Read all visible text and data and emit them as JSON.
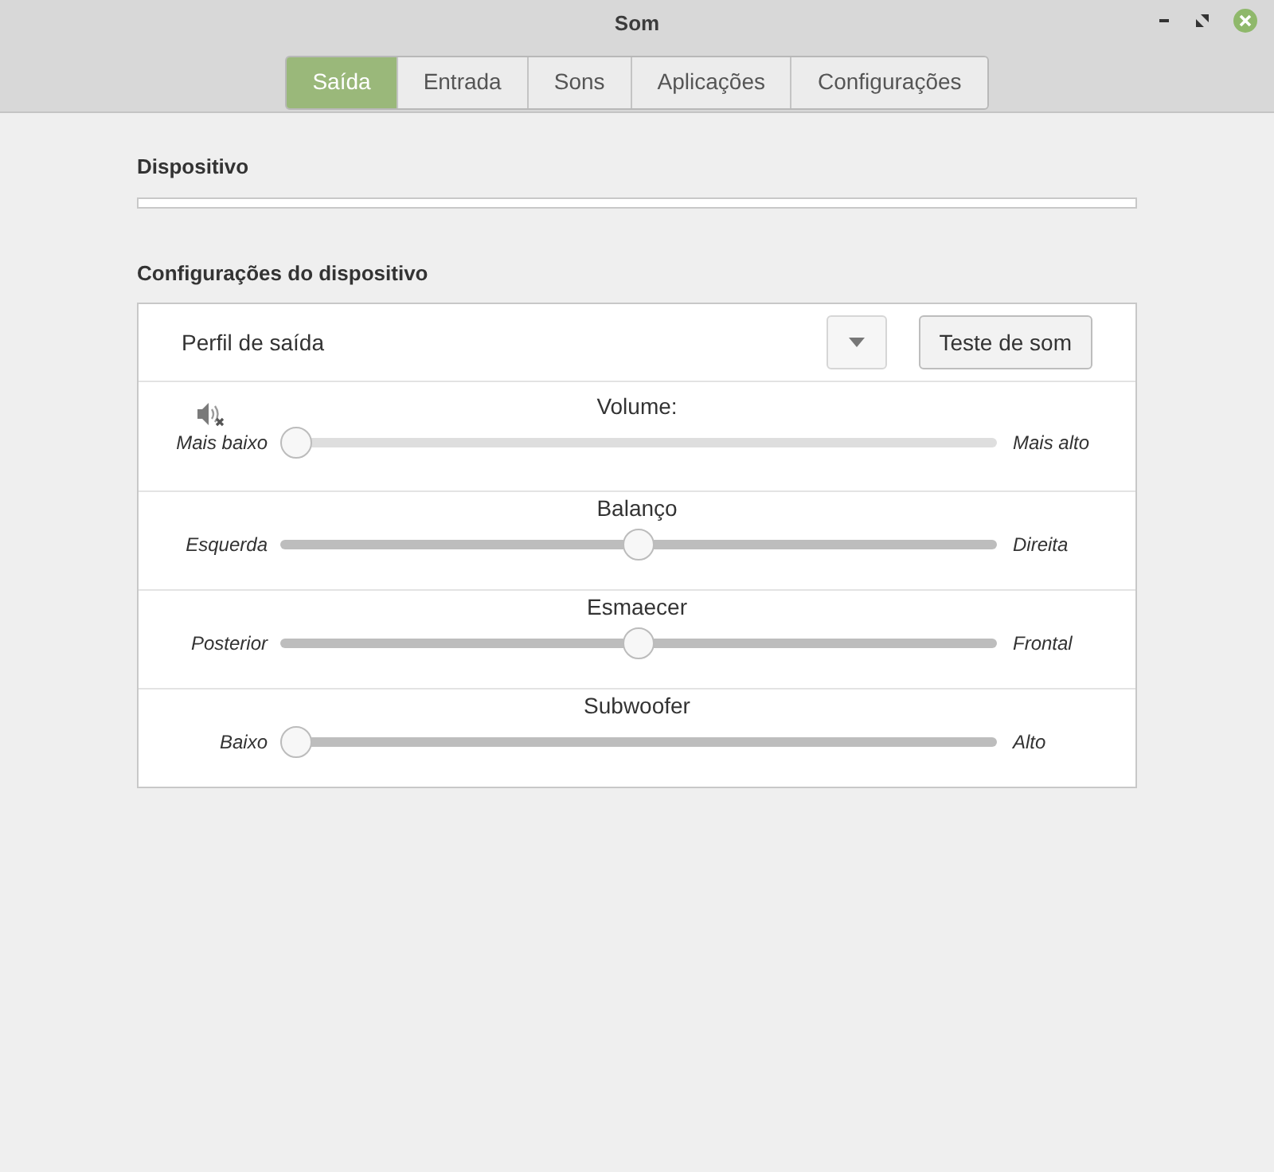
{
  "window": {
    "title": "Som"
  },
  "tabs": [
    {
      "label": "Saída",
      "selected": true
    },
    {
      "label": "Entrada",
      "selected": false
    },
    {
      "label": "Sons",
      "selected": false
    },
    {
      "label": "Aplicações",
      "selected": false
    },
    {
      "label": "Configurações",
      "selected": false
    }
  ],
  "device": {
    "heading": "Dispositivo"
  },
  "settings": {
    "heading": "Configurações do dispositivo",
    "profile_label": "Perfil de saída",
    "test_button": "Teste de som",
    "sliders": [
      {
        "title": "Volume:",
        "min_label": "Mais baixo",
        "max_label": "Mais alto",
        "level": 0,
        "disabled": true,
        "muted_icon": true
      },
      {
        "title": "Balanço",
        "min_label": "Esquerda",
        "max_label": "Direita",
        "level": 0.5,
        "disabled": false,
        "muted_icon": false
      },
      {
        "title": "Esmaecer",
        "min_label": "Posterior",
        "max_label": "Frontal",
        "level": 0.5,
        "disabled": false,
        "muted_icon": false
      },
      {
        "title": "Subwoofer",
        "min_label": "Baixo",
        "max_label": "Alto",
        "level": 0,
        "disabled": false,
        "muted_icon": false
      }
    ]
  }
}
